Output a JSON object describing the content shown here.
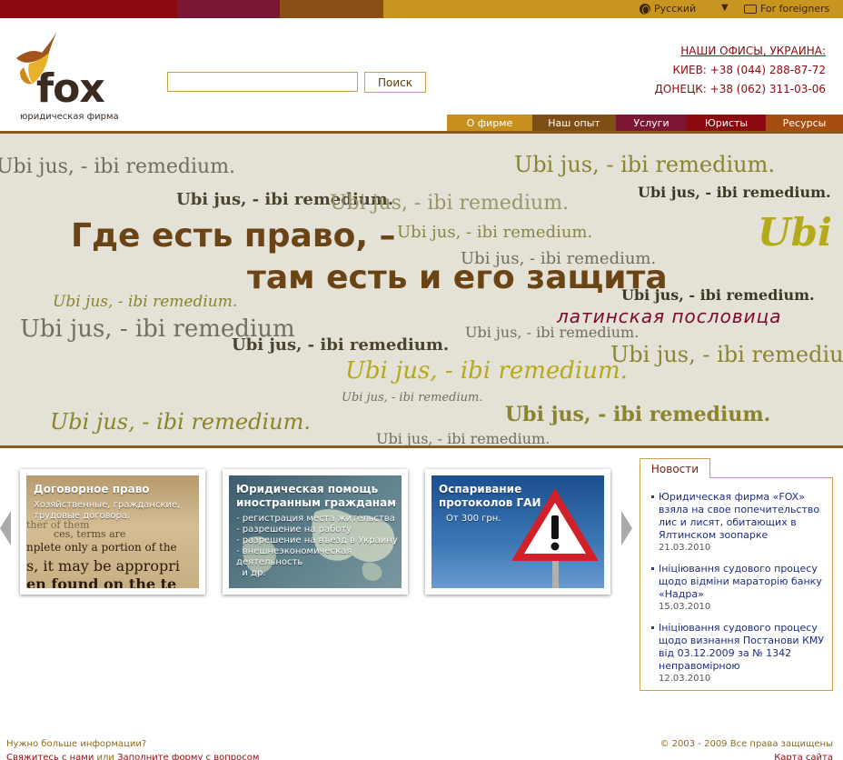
{
  "topbar": {
    "language_label": "Русский",
    "foreigners_label": "For foreigners"
  },
  "logo": {
    "name": "fox",
    "subtitle": "юридическая фирма"
  },
  "search": {
    "value": "",
    "placeholder": "",
    "button_label": "Поиск"
  },
  "offices": {
    "title": "НАШИ ОФИСЫ, УКРАИНА:",
    "lines": [
      "КИЕВ: +38 (044) 288-87-72",
      "ДОНЕЦК: +38 (062) 311-03-06"
    ]
  },
  "nav": {
    "items": [
      "О фирме",
      "Наш опыт",
      "Услуги",
      "Юристы",
      "Ресурсы"
    ]
  },
  "banner": {
    "line1": "Где есть право, –",
    "line2": "там есть и его защита",
    "proverb": "латинская пословица",
    "background_phrase_dash": "Ubi jus, - ibi remedium.",
    "background_phrase": "Ubi jus, - ibi remedium",
    "background_word": "Ubi"
  },
  "cards": [
    {
      "title": "Договорное право",
      "lines": [
        "Хозяйственные, гражданские,",
        "трудовые  договора."
      ],
      "paper_lines": [
        "ther of them",
        "ces, terms are",
        "nplete only a portion of the",
        "s, it may be appropri",
        "en found on the te"
      ]
    },
    {
      "title_lines": [
        "Юридическая помощь",
        "иностранным гражданам"
      ],
      "lines": [
        "- регистрация места жительства",
        "- разрешение на работу",
        "- разрешение на въезд в Украину",
        "- внешнеэкономическая деятельность",
        "  и др."
      ]
    },
    {
      "title_lines": [
        "Оспаривание",
        "протоколов ГАИ"
      ],
      "lines": [
        "От 300 грн."
      ]
    }
  ],
  "news": {
    "tab_label": "Новости",
    "items": [
      {
        "title": "Юридическая фирма «FOX» взяла на свое попечительство лис и лисят, обитающих в Ялтинском зоопарке",
        "date": "21.03.2010"
      },
      {
        "title": "Ініціювання судового процесу щодо відміни мараторію банку «Надра»",
        "date": "15.03.2010"
      },
      {
        "title": "Ініціювання судового процесу щодо визнання Постанови КМУ від 03.12.2009 за № 1342 неправомірною",
        "date": "12.03.2010"
      }
    ]
  },
  "footer": {
    "question": "Нужно больше информации?",
    "contact_link": "Свяжитесь с нами",
    "or_text": "или",
    "form_link": "Заполните форму с вопросом",
    "copyright": "© 2003 - 2009 Все права защищены",
    "sitemap_link": "Карта сайта"
  },
  "colors": {
    "brand_dark_red": "#8b0a10",
    "brand_gold": "#c99521",
    "brand_brown": "#6b4416",
    "news_link": "#1d2c80"
  }
}
